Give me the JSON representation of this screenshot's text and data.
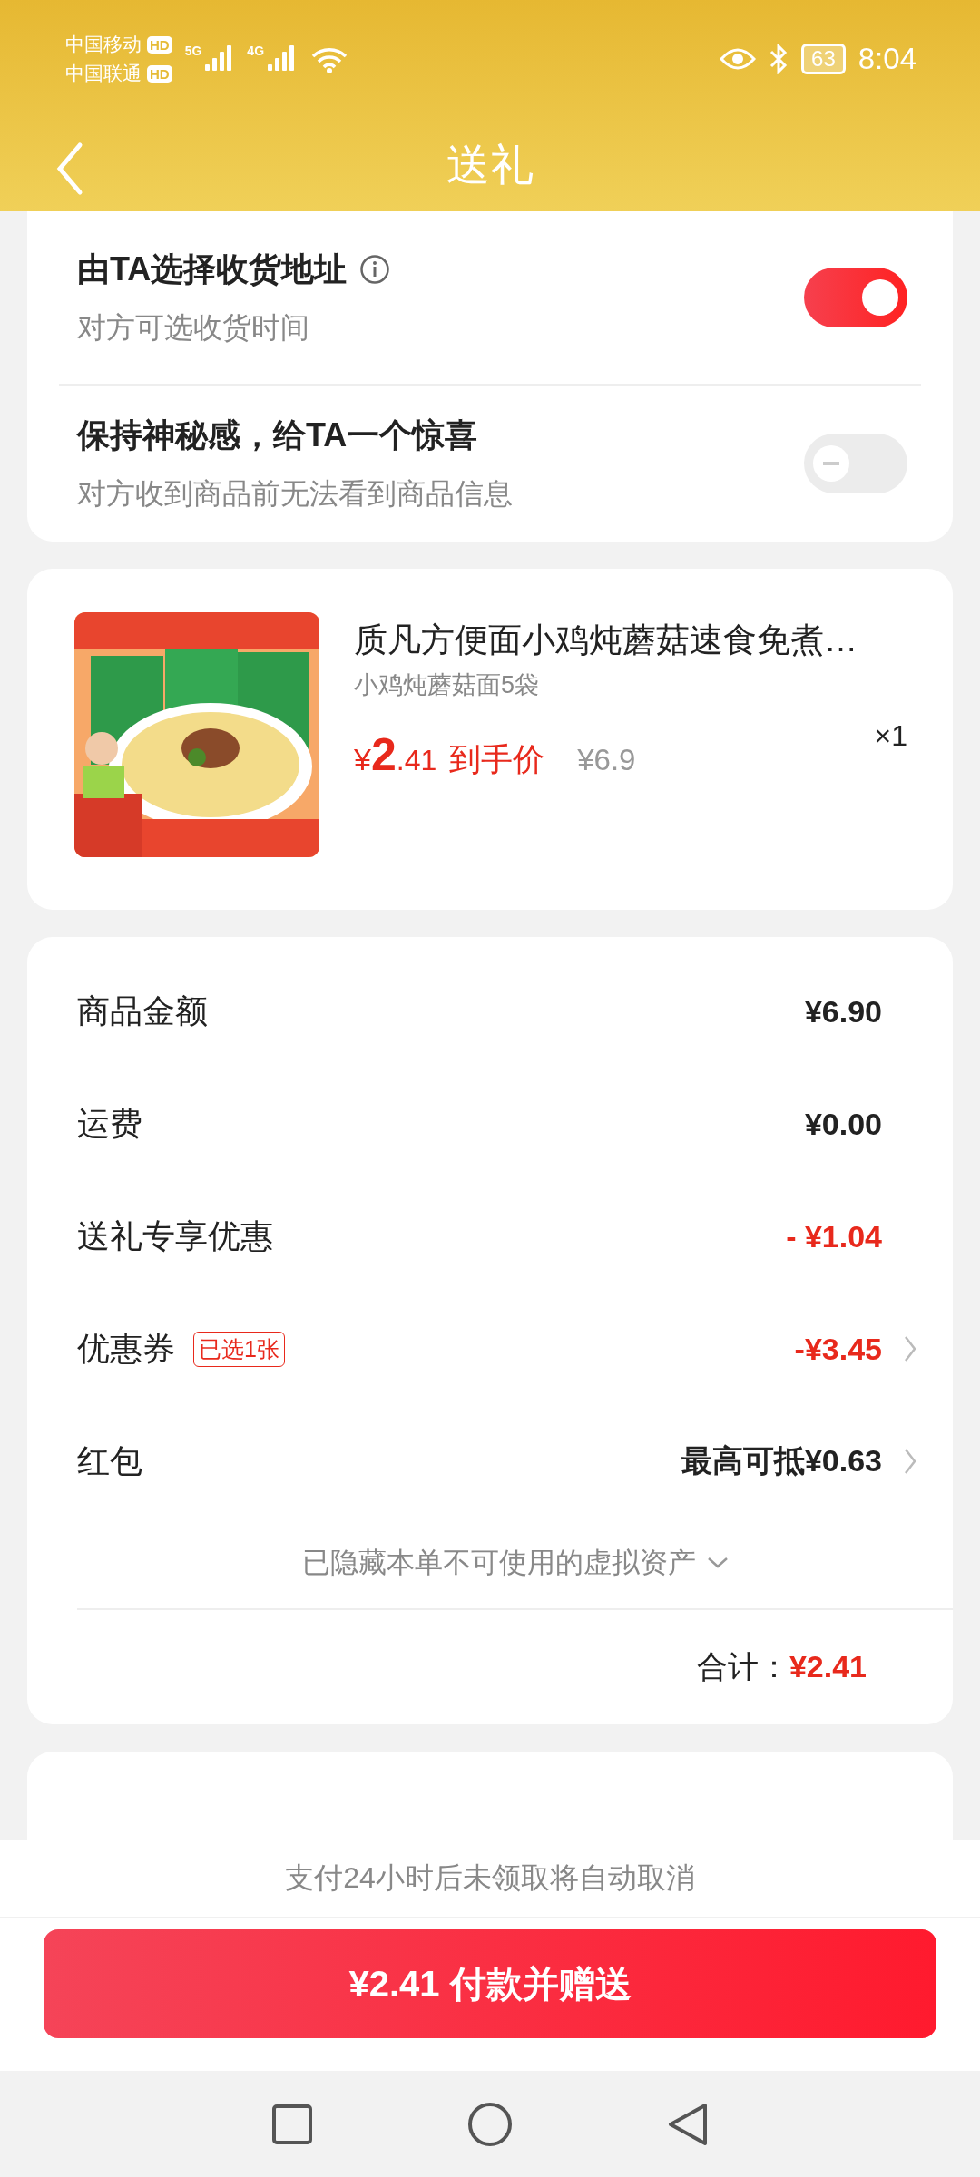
{
  "status_bar": {
    "carriers": [
      {
        "name": "中国移动",
        "badge": "HD"
      },
      {
        "name": "中国联通",
        "badge": "HD"
      }
    ],
    "networks": [
      "5G",
      "4G"
    ],
    "battery": "63",
    "time": "8:04"
  },
  "header": {
    "title": "送礼"
  },
  "settings": [
    {
      "title": "由TA选择收货地址",
      "subtitle": "对方可选收货时间",
      "info_icon": true,
      "on": true
    },
    {
      "title": "保持神秘感，给TA一个惊喜",
      "subtitle": "对方收到商品前无法看到商品信息",
      "info_icon": false,
      "on": false
    }
  ],
  "product": {
    "name": "质凡方便面小鸡炖蘑菇速食免煮…",
    "variant": "小鸡炖蘑菇面5袋",
    "currency": "¥",
    "price_int": "2",
    "price_dec": ".41",
    "price_label": "到手价",
    "original_price": "¥6.9",
    "quantity": "×1"
  },
  "summary": {
    "rows": [
      {
        "label": "商品金额",
        "value": "¥6.90",
        "highlight": false,
        "chevron": false
      },
      {
        "label": "运费",
        "value": "¥0.00",
        "highlight": false,
        "chevron": false
      },
      {
        "label": "送礼专享优惠",
        "value": "- ¥1.04",
        "highlight": true,
        "chevron": false
      },
      {
        "label": "优惠券",
        "tag": "已选1张",
        "value": "-¥3.45",
        "highlight": true,
        "chevron": true
      },
      {
        "label": "红包",
        "value": "最高可抵¥0.63",
        "highlight": false,
        "chevron": true
      }
    ],
    "hidden_note": "已隐藏本单不可使用的虚拟资产",
    "total_label": "合计：",
    "total_value": "¥2.41"
  },
  "notice": "支付24小时后未领取将自动取消",
  "pay_button": "¥2.41 付款并赠送"
}
